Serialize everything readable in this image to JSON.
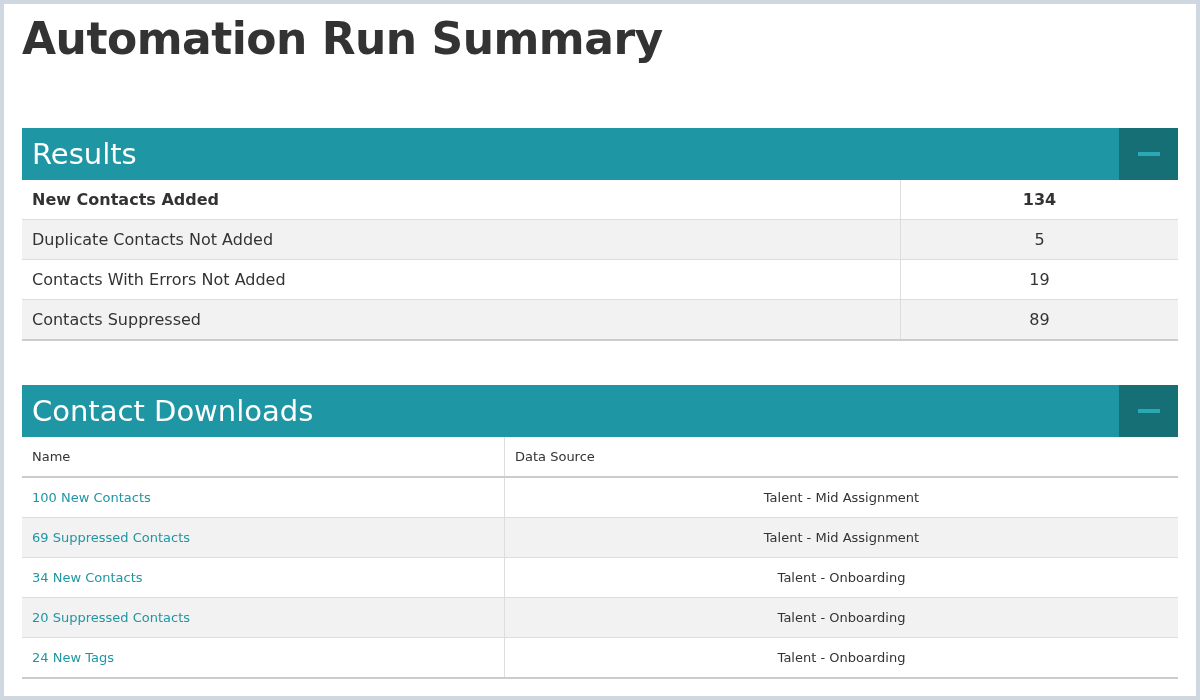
{
  "title": "Automation Run Summary",
  "results": {
    "title": "Results",
    "rows": [
      {
        "label": "New Contacts Added",
        "value": "134",
        "emphasized": true
      },
      {
        "label": "Duplicate Contacts Not Added",
        "value": "5",
        "emphasized": false
      },
      {
        "label": "Contacts With Errors Not Added",
        "value": "19",
        "emphasized": false
      },
      {
        "label": "Contacts Suppressed",
        "value": "89",
        "emphasized": false
      }
    ]
  },
  "downloads": {
    "title": "Contact Downloads",
    "columns": [
      "Name",
      "Data Source"
    ],
    "rows": [
      {
        "name": "100 New Contacts",
        "source": "Talent - Mid Assignment"
      },
      {
        "name": "69 Suppressed Contacts",
        "source": "Talent - Mid Assignment"
      },
      {
        "name": "34 New Contacts",
        "source": "Talent - Onboarding"
      },
      {
        "name": "20 Suppressed Contacts",
        "source": "Talent - Onboarding"
      },
      {
        "name": "24 New Tags",
        "source": "Talent - Onboarding"
      }
    ]
  }
}
